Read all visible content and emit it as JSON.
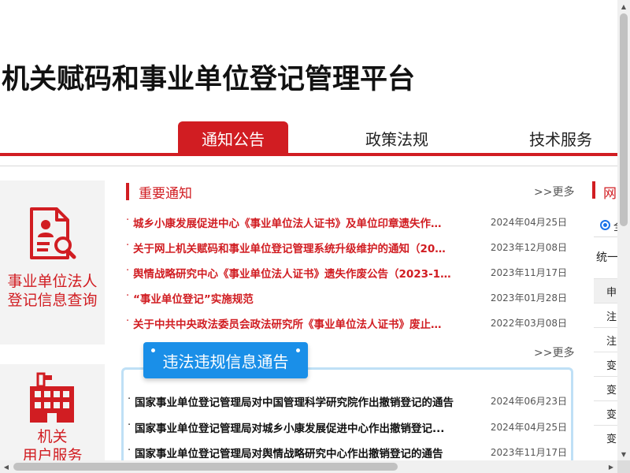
{
  "site": {
    "title": "机关赋码和事业单位登记管理平台"
  },
  "nav": {
    "tabs": [
      {
        "label": "通知公告",
        "active": true
      },
      {
        "label": "政策法规",
        "active": false
      },
      {
        "label": "技术服务",
        "active": false
      }
    ]
  },
  "left_cards": [
    {
      "label_line1": "事业单位法人",
      "label_line2": "登记信息查询",
      "icon": "document-search-icon"
    },
    {
      "label_line1": "机关",
      "label_line2": "用户服务",
      "icon": "office-building-icon"
    }
  ],
  "important_notices": {
    "title": "重要通知",
    "more": "更多",
    "items": [
      {
        "title": "城乡小康发展促进中心《事业单位法人证书》及单位印章遗失作…",
        "date": "2024年04月25日"
      },
      {
        "title": "关于网上机关赋码和事业单位登记管理系统升级维护的通知（20…",
        "date": "2023年12月08日"
      },
      {
        "title": "舆情战略研究中心《事业单位法人证书》遗失作废公告（2023-1…",
        "date": "2023年11月17日"
      },
      {
        "title": "“事业单位登记”实施规范",
        "date": "2023年01月28日"
      },
      {
        "title": "关于中共中央政法委员会政法研究所《事业单位法人证书》废止…",
        "date": "2022年03月08日"
      }
    ]
  },
  "violations": {
    "title": "违法违规信息通告",
    "more": "更多",
    "items": [
      {
        "title": "国家事业单位登记管理局对中国管理科学研究院作出撤销登记的通告",
        "date": "2024年06月23日"
      },
      {
        "title": "国家事业单位登记管理局对城乡小康发展促进中心作出撤销登记...",
        "date": "2024年04月25日"
      },
      {
        "title": "国家事业单位登记管理局对舆情战略研究中心作出撤销登记的通告",
        "date": "2023年11月17日"
      }
    ]
  },
  "right_panel": {
    "title": "网",
    "radio_label": "全",
    "field_label": "统一",
    "cells": [
      "申",
      "注",
      "注",
      "变",
      "变",
      "变",
      "变"
    ]
  },
  "colors": {
    "brand_red": "#d11d22",
    "badge_blue": "#1a8fe8",
    "box_border": "#bfe0f6"
  }
}
